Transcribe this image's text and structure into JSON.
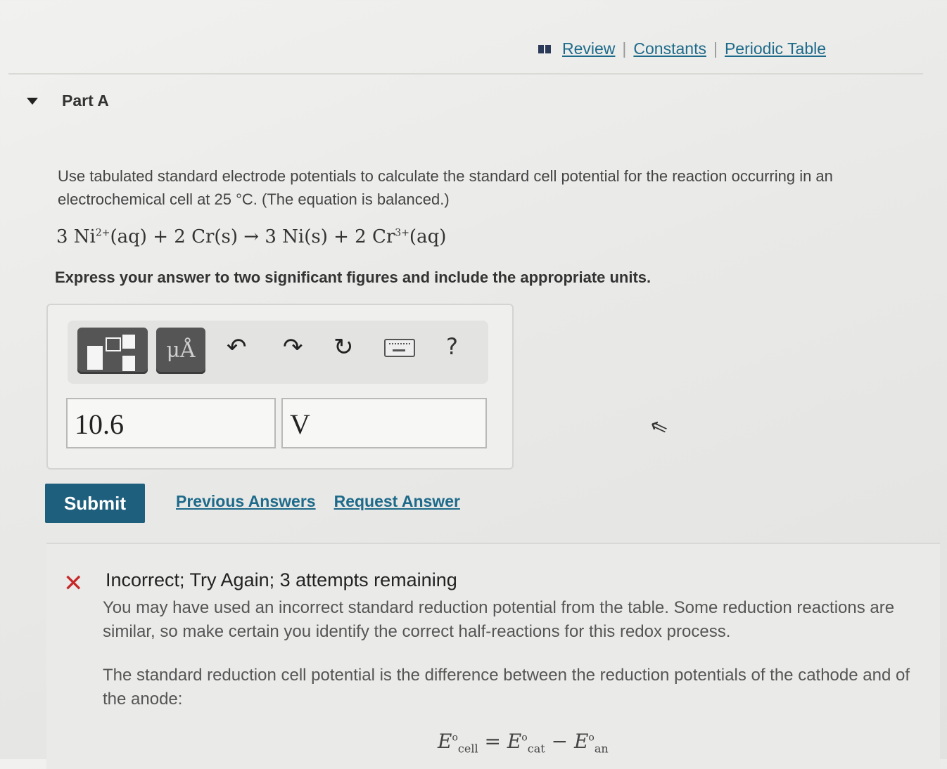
{
  "header_links": {
    "review": "Review",
    "constants": "Constants",
    "periodic_table": "Periodic Table",
    "separator": "|"
  },
  "part": {
    "title": "Part A"
  },
  "question": {
    "prompt": "Use tabulated standard electrode potentials to calculate the standard cell potential for the reaction occurring in an electrochemical cell at 25 °C. (The equation is balanced.)",
    "equation": {
      "c1": "3 Ni",
      "sup1": "2+",
      "r1": "(aq) + 2 Cr(s) → 3 Ni(s) + 2 Cr",
      "sup2": "3+",
      "r2": "(aq)"
    },
    "instruction": "Express your answer to two significant figures and include the appropriate units."
  },
  "toolbar": {
    "units_label": "μÅ",
    "undo": "↶",
    "redo": "↷",
    "reset": "↻",
    "help": "?"
  },
  "answer": {
    "value": "10.6",
    "unit": "V"
  },
  "actions": {
    "submit": "Submit",
    "previous_answers": "Previous Answers",
    "request_answer": "Request Answer"
  },
  "feedback": {
    "icon": "✕",
    "title": "Incorrect; Try Again; 3 attempts remaining",
    "p1": "You may have used an incorrect standard reduction potential from the table. Some reduction reactions are similar, so make certain you identify the correct half-reactions for this redox process.",
    "p2": "The standard reduction cell potential is the difference between the reduction potentials of the cathode and of the anode:",
    "formula": {
      "e": "E",
      "deg": "o",
      "cell": "cell",
      "cat": "cat",
      "an": "an",
      "eq": "=",
      "minus": "−"
    }
  },
  "colors": {
    "submit": "#1f5f7e",
    "link": "#1d6a8a",
    "error": "#c62828"
  }
}
